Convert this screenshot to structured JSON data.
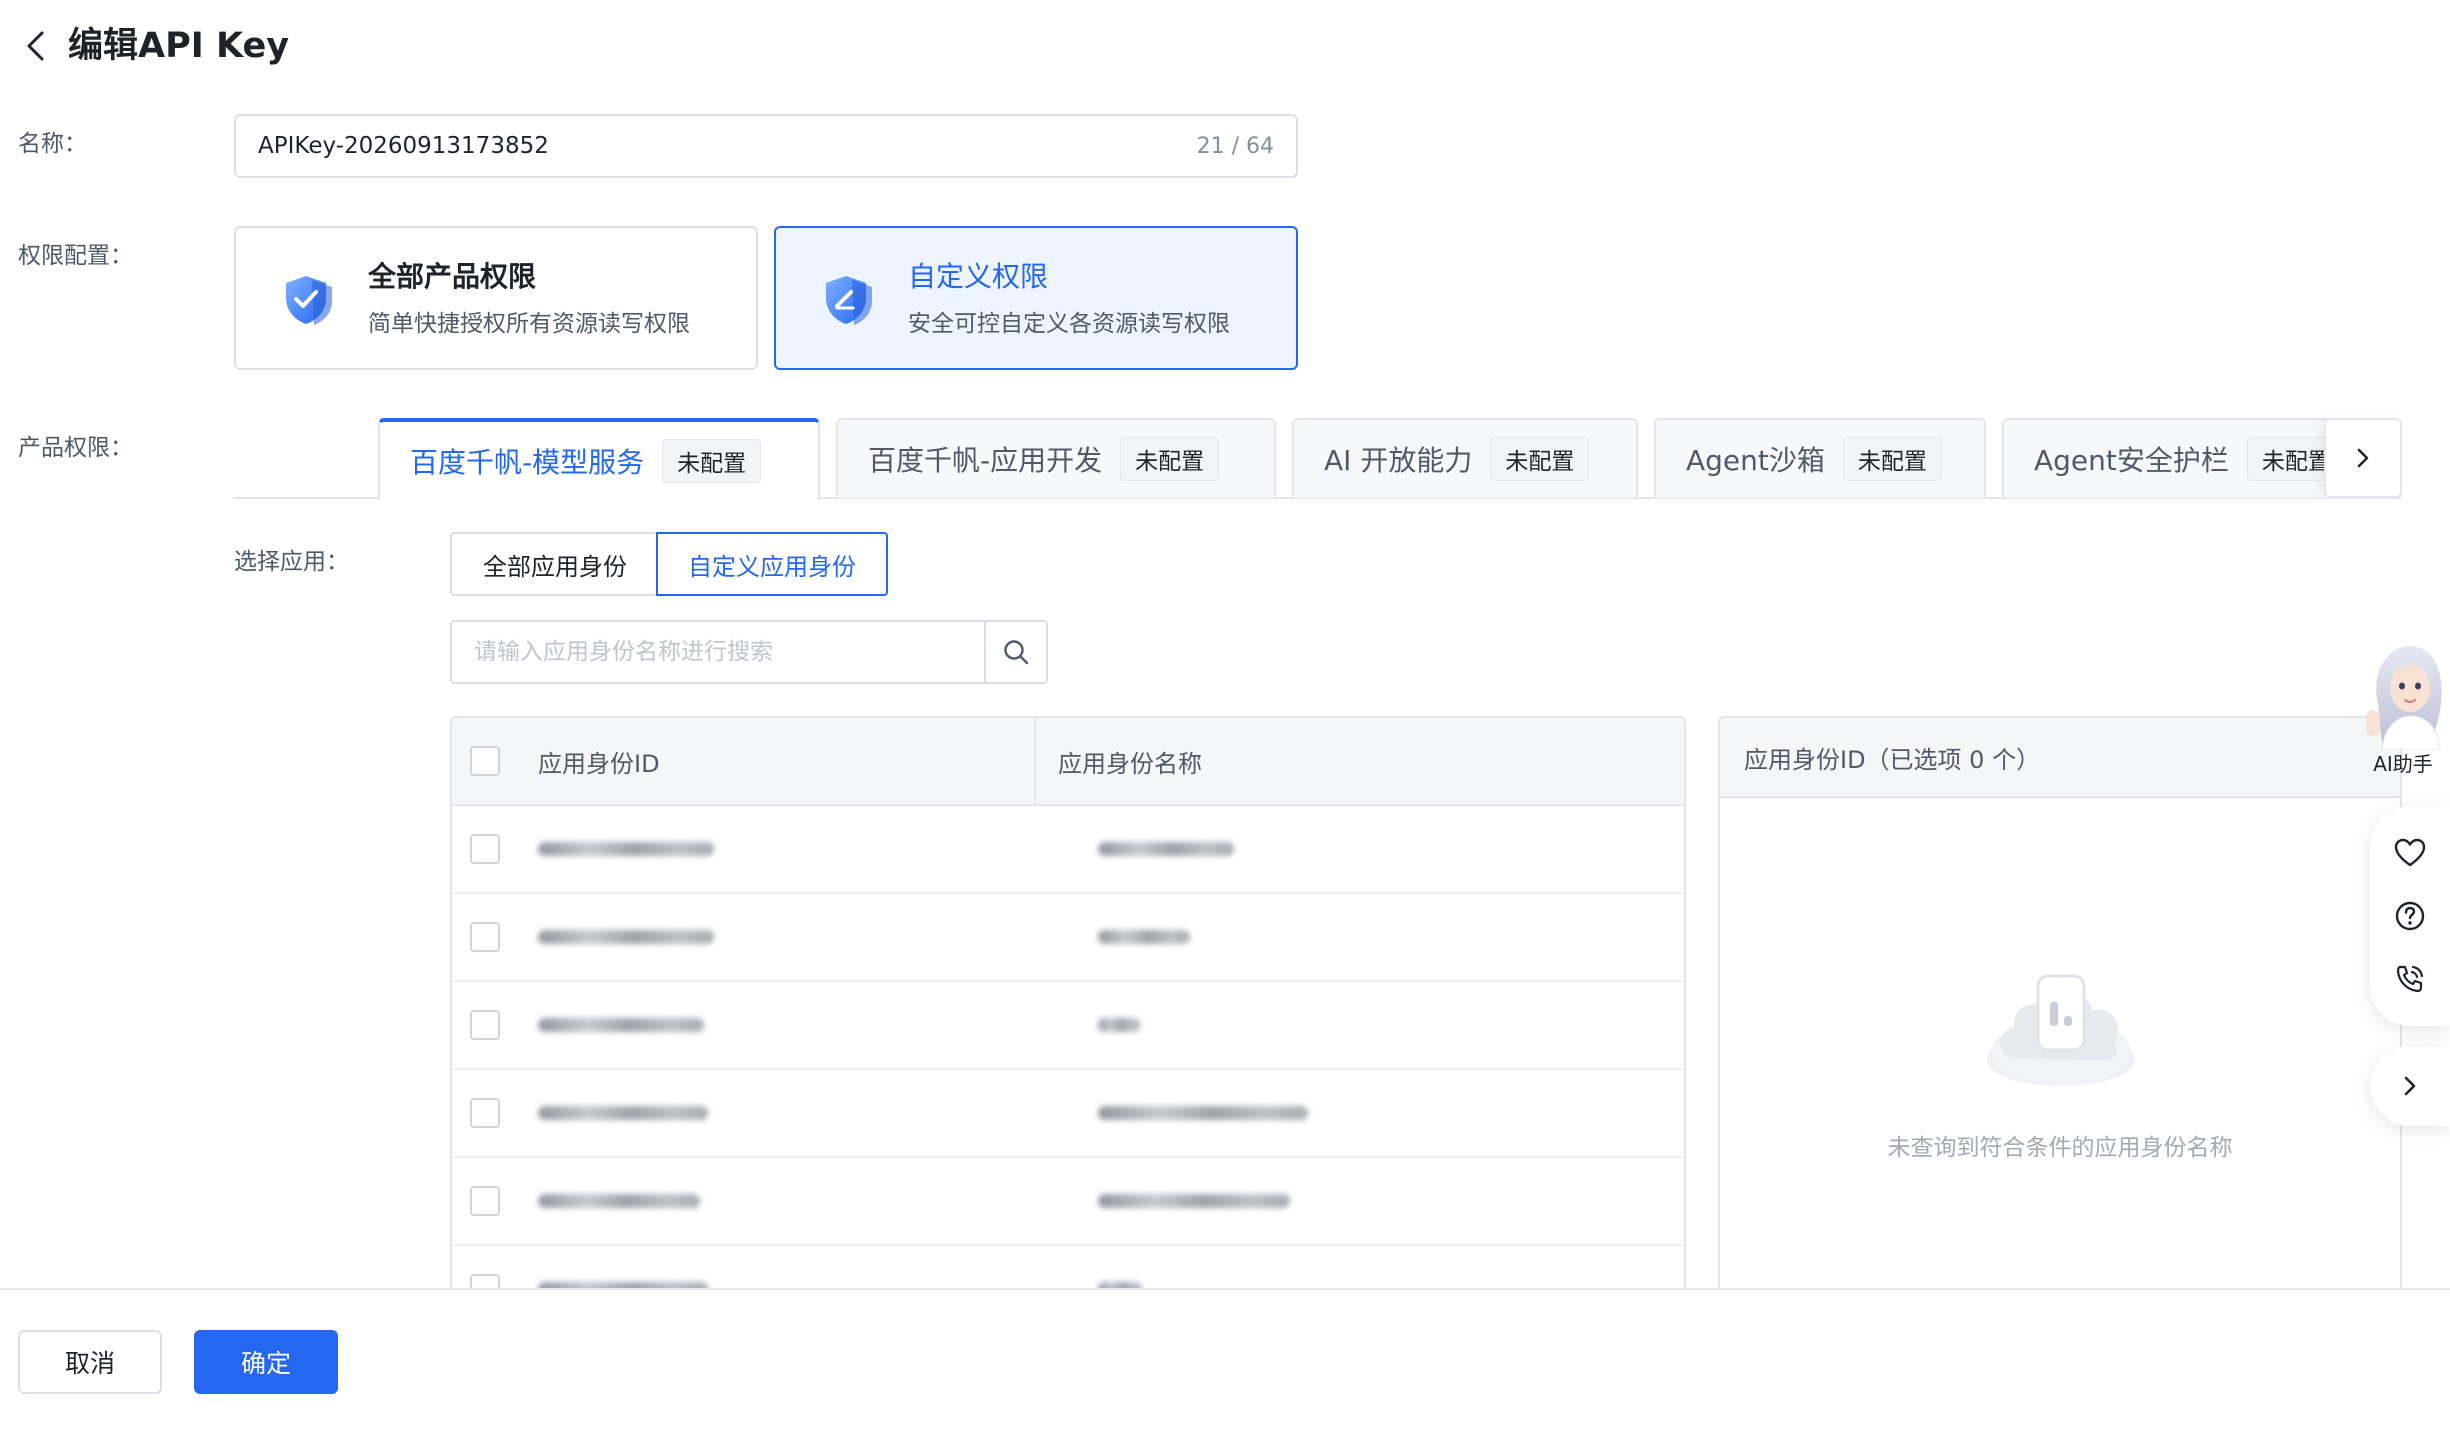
{
  "header": {
    "title": "编辑API Key"
  },
  "name_row": {
    "label": "名称：",
    "value": "APIKey-20260913173852",
    "count": "21 / 64"
  },
  "permission_row": {
    "label": "权限配置：",
    "cards": [
      {
        "title": "全部产品权限",
        "desc": "简单快捷授权所有资源读写权限",
        "active": false
      },
      {
        "title": "自定义权限",
        "desc": "安全可控自定义各资源读写权限",
        "active": true
      }
    ]
  },
  "product_row": {
    "label": "产品权限：",
    "tabs": [
      {
        "label": "百度千帆-模型服务",
        "badge": "未配置"
      },
      {
        "label": "百度千帆-应用开发",
        "badge": "未配置"
      },
      {
        "label": "AI 开放能力",
        "badge": "未配置"
      },
      {
        "label": "Agent沙箱",
        "badge": "未配置"
      },
      {
        "label": "Agent安全护栏",
        "badge": "未配置"
      }
    ]
  },
  "app_select": {
    "label": "选择应用：",
    "options": [
      "全部应用身份",
      "自定义应用身份"
    ],
    "selected": "自定义应用身份",
    "search_placeholder": "请输入应用身份名称进行搜索"
  },
  "table": {
    "columns": [
      "应用身份ID",
      "应用身份名称"
    ],
    "row_count": 6
  },
  "selected_panel": {
    "header": "应用身份ID（已选项 0 个）",
    "empty_text": "未查询到符合条件的应用身份名称"
  },
  "assistant": {
    "label": "AI助手"
  },
  "footer": {
    "cancel_label": "取消",
    "ok_label": "确定"
  },
  "colors": {
    "primary": "#2468f2",
    "border": "#dcdfe6",
    "text": "#1f2329",
    "muted": "#4e5969"
  }
}
